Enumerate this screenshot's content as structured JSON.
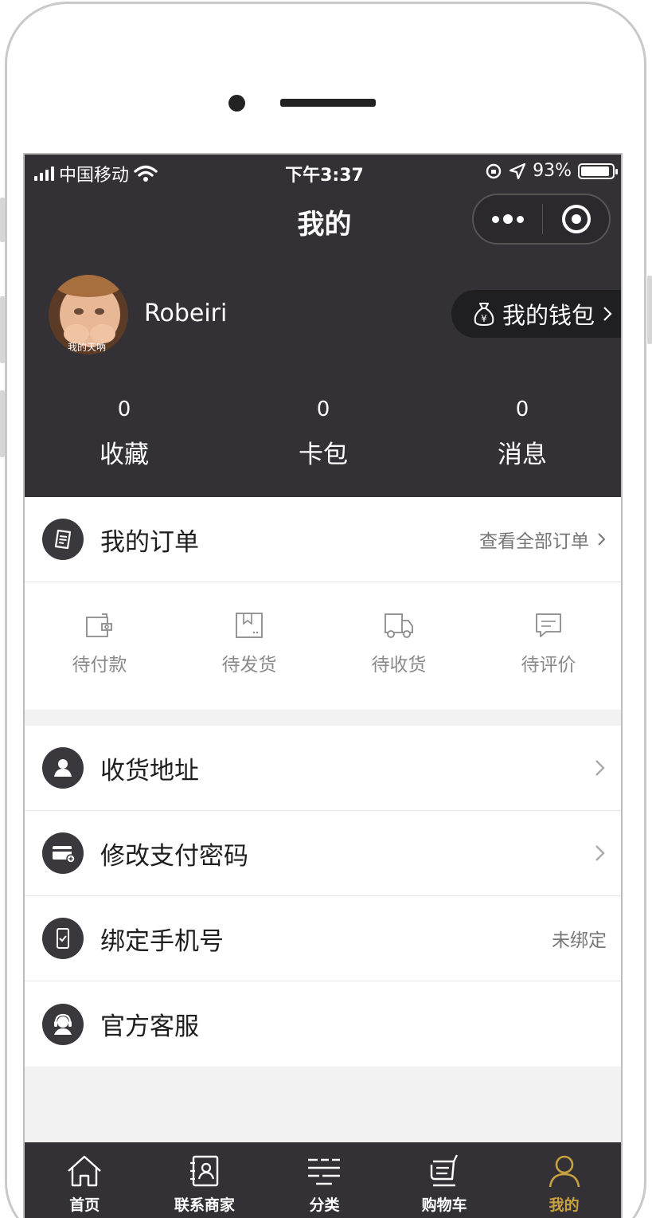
{
  "status_bar": {
    "carrier": "中国移动",
    "time": "下午3:37",
    "battery": "93%"
  },
  "nav": {
    "title": "我的"
  },
  "profile": {
    "avatar_caption": "我的天呐",
    "username": "Robeiri",
    "wallet_label": "我的钱包"
  },
  "stats": [
    {
      "value": "0",
      "label": "收藏"
    },
    {
      "value": "0",
      "label": "卡包"
    },
    {
      "value": "0",
      "label": "消息"
    }
  ],
  "orders": {
    "title": "我的订单",
    "view_all": "查看全部订单",
    "tabs": [
      {
        "label": "待付款",
        "icon": "wallet-icon"
      },
      {
        "label": "待发货",
        "icon": "package-icon"
      },
      {
        "label": "待收货",
        "icon": "truck-icon"
      },
      {
        "label": "待评价",
        "icon": "comment-icon"
      }
    ]
  },
  "menu": [
    {
      "label": "收货地址",
      "icon": "user-icon",
      "value": ""
    },
    {
      "label": "修改支付密码",
      "icon": "card-icon",
      "value": ""
    },
    {
      "label": "绑定手机号",
      "icon": "phone-icon",
      "value": "未绑定"
    },
    {
      "label": "官方客服",
      "icon": "headset-icon",
      "value": ""
    }
  ],
  "tabbar": [
    {
      "label": "首页",
      "icon": "home-icon"
    },
    {
      "label": "联系商家",
      "icon": "contact-icon"
    },
    {
      "label": "分类",
      "icon": "category-icon"
    },
    {
      "label": "购物车",
      "icon": "cart-icon"
    },
    {
      "label": "我的",
      "icon": "profile-icon"
    }
  ],
  "colors": {
    "header_bg": "#333135",
    "tab_active": "#c9a23f",
    "page_bg": "#f2f2f2"
  }
}
